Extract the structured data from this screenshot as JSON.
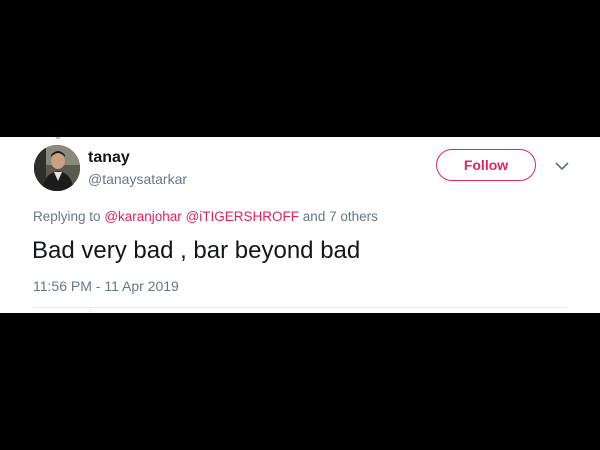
{
  "tweet": {
    "display_name": "tanay",
    "handle": "@tanaysatarkar",
    "follow_label": "Follow",
    "replying_prefix": "Replying to",
    "mentions": [
      "@karanjohar",
      "@iTIGERSHROFF"
    ],
    "replying_suffix": "and 7 others",
    "text": "Bad very bad , bar beyond bad",
    "timestamp": "11:56 PM - 11 Apr 2019"
  },
  "icons": {
    "avatar": "user-avatar-photo",
    "more": "chevron-down-icon"
  },
  "colors": {
    "accent": "#e0245e",
    "secondary_text": "#657786",
    "primary_text": "#14171a",
    "background": "#000000",
    "card": "#ffffff"
  }
}
